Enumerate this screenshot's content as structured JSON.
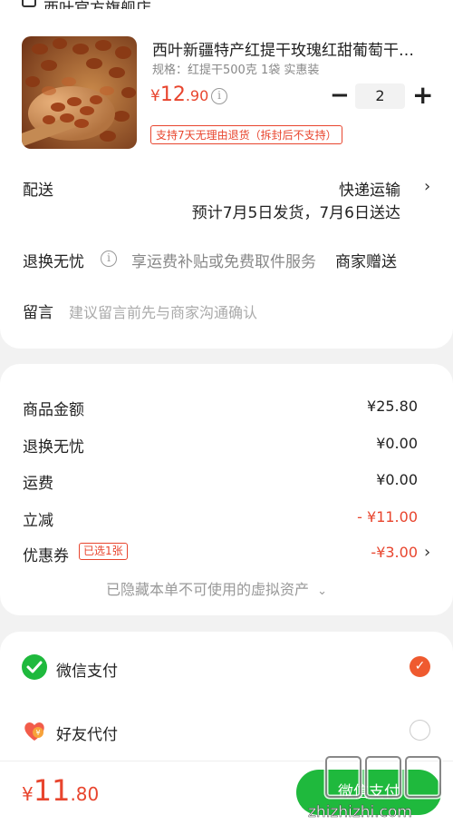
{
  "store": {
    "name": "西叶官方旗舰店"
  },
  "product": {
    "name": "西叶新疆特产红提干玫瑰红甜葡萄干…",
    "spec": "规格：红提干500克 1袋 实惠装",
    "price_currency": "¥",
    "price_int": "12",
    "price_dec": ".90",
    "quantity": "2",
    "return_badge": "支持7天无理由退货（拆封后不支持）"
  },
  "delivery": {
    "label": "配送",
    "method": "快递运输",
    "estimate": "预计7月5日发货，7月6日送达"
  },
  "worry_free": {
    "label": "退换无忧",
    "desc": "享运费补贴或免费取件服务",
    "gift": "商家赠送"
  },
  "message": {
    "label": "留言",
    "placeholder": "建议留言前先与商家沟通确认"
  },
  "fees": {
    "goods_label": "商品金额",
    "goods_value": "¥25.80",
    "worry_label": "退换无忧",
    "worry_value": "¥0.00",
    "shipping_label": "运费",
    "shipping_value": "¥0.00",
    "discount_label": "立减",
    "discount_value": "- ¥11.00",
    "coupon_label": "优惠券",
    "coupon_badge": "已选1张",
    "coupon_value": "-¥3.00",
    "hidden_note": "已隐藏本单不可使用的虚拟资产",
    "hidden_chevron": "⌄"
  },
  "payment": {
    "wechat_label": "微信支付",
    "friend_label": "好友代付",
    "wechat_selected": true
  },
  "bottom": {
    "total_currency": "¥",
    "total_int": "11",
    "total_dec": ".80",
    "pay_button": "微信支付"
  },
  "icons": {
    "chevron": "›",
    "info": "i",
    "minus": "−",
    "plus": "+",
    "check": "✓"
  },
  "watermark": {
    "text": "值 什么值得买",
    "site": "zhizhizhi.com"
  },
  "colors": {
    "accent": "#e8452e",
    "wechat_green": "#1fb93d",
    "radio_selected": "#ef5a2f"
  }
}
